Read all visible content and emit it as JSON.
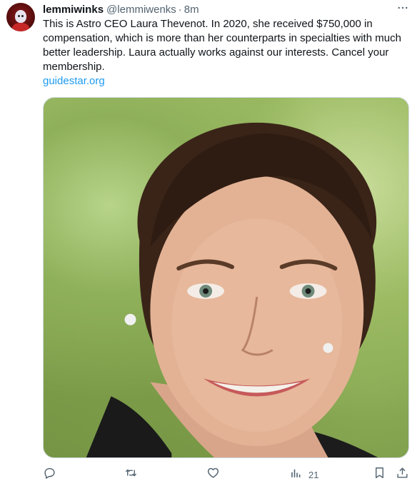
{
  "tweet": {
    "display_name": "lemmiwinks",
    "handle": "@lemmiwenks",
    "separator": "·",
    "time": "8m",
    "text": "This is Astro CEO Laura Thevenot. In 2020, she received $750,000 in compensation, which is more than her counterparts in specialties with much better leadership. Laura actually works against our interests. Cancel your membership.",
    "link": "guidestar.org",
    "more_icon": "more-horizontal-icon"
  },
  "actions": {
    "reply_icon": "reply-icon",
    "retweet_icon": "retweet-icon",
    "like_icon": "like-icon",
    "views_icon": "views-icon",
    "views_count": "21",
    "bookmark_icon": "bookmark-icon",
    "share_icon": "share-icon"
  },
  "colors": {
    "text": "#0f1419",
    "secondary": "#536471",
    "link": "#1d9bf0",
    "border": "#cfd9de"
  }
}
